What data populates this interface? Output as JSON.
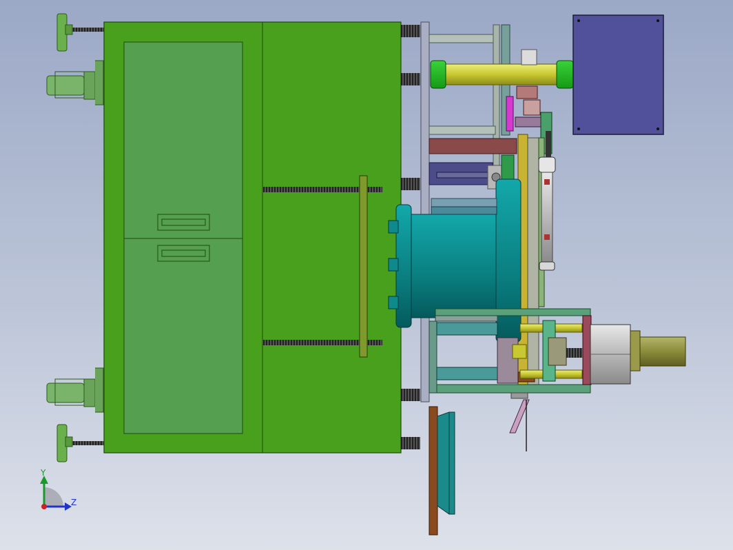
{
  "triad": {
    "y_label": "Y",
    "z_label": "Z",
    "colors": {
      "y": "#1a9a2a",
      "z": "#2233cc",
      "x": "#cc2222"
    }
  },
  "palette": {
    "cabinet": "#48a01c",
    "cabinet_panel": "#55a050",
    "drive_motor": "#51509a",
    "cylinder": "#0e8a8c",
    "guide_rod": "#c8c832",
    "motor_cap": "#8c8c3c",
    "leveling_foot": "#6ab04c"
  }
}
